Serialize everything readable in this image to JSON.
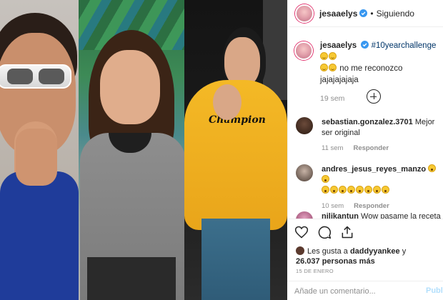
{
  "post": {
    "author": "jesaaelys",
    "separator": "•",
    "follow_status": "Siguiendo"
  },
  "caption": {
    "author": "jesaaelys",
    "hashtag": "#10yearchallenge",
    "text": "no me reconozco jajajajajaja",
    "time": "19 sem"
  },
  "comments": [
    {
      "user": "sebastian.gonzalez.3701",
      "text": "Mejor ser original",
      "time": "11 sem",
      "reply": "Responder"
    },
    {
      "user": "andres_jesus_reyes_manzo",
      "text": "",
      "time": "10 sem",
      "reply": "Responder"
    },
    {
      "user": "nilikantun",
      "text": "Wow pasame la receta",
      "time": "",
      "reply": ""
    }
  ],
  "likes": {
    "prefix": "Les gusta a",
    "user": "daddyyankee",
    "conj": "y",
    "count": "26.037 personas más"
  },
  "date": "15 DE ENERO",
  "comment_box": {
    "placeholder": "Añade un comentario...",
    "publish": "Publi"
  },
  "hoodie_text": "Champion",
  "icons": [
    "verified-badge-icon",
    "add-comments-icon",
    "heart-icon",
    "comment-icon",
    "share-icon"
  ],
  "colors": {
    "hashtag": "#003569",
    "muted": "#8e8e8e",
    "publish": "#b2dffc",
    "hoodie": "#f2b21f"
  }
}
